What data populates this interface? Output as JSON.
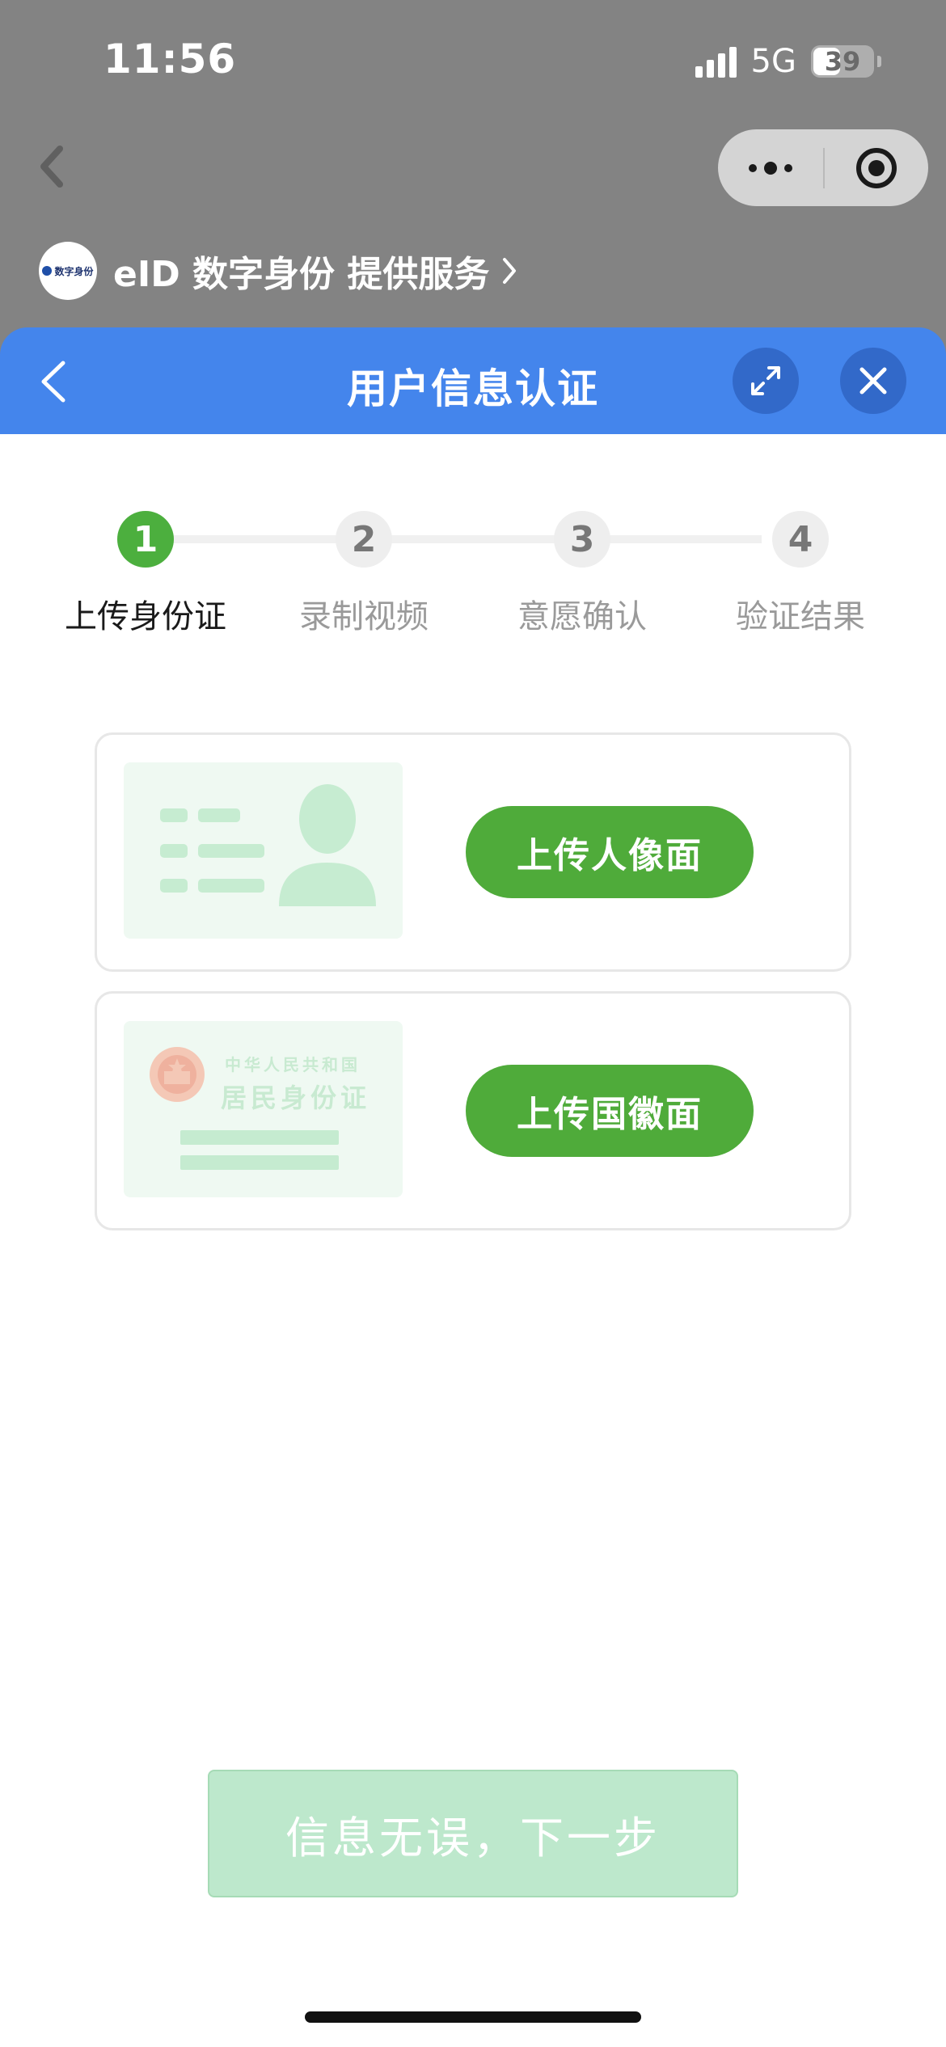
{
  "status_bar": {
    "time": "11:56",
    "network": "5G",
    "battery": "39"
  },
  "provider": {
    "logo_text": "数字身份",
    "label": "eID 数字身份 提供服务"
  },
  "header": {
    "title": "用户信息认证"
  },
  "stepper": {
    "steps": [
      {
        "number": "1",
        "label": "上传身份证",
        "state": "active"
      },
      {
        "number": "2",
        "label": "录制视频",
        "state": "pending"
      },
      {
        "number": "3",
        "label": "意愿确认",
        "state": "pending"
      },
      {
        "number": "4",
        "label": "验证结果",
        "state": "pending"
      }
    ]
  },
  "cards": {
    "front": {
      "button_label": "上传人像面"
    },
    "back": {
      "button_label": "上传国徽面",
      "card_title_small": "中华人民共和国",
      "card_title_big": "居民身份证"
    }
  },
  "footer": {
    "next_label": "信息无误，下一步"
  },
  "colors": {
    "header_blue": "#4485ec",
    "accent_green": "#4fab3a",
    "disabled_green": "#bde8cc"
  },
  "icons": [
    "back-chevron-icon",
    "more-dots-icon",
    "target-circle-icon",
    "expand-icon",
    "close-icon",
    "id-card-front-icon",
    "national-emblem-icon"
  ]
}
